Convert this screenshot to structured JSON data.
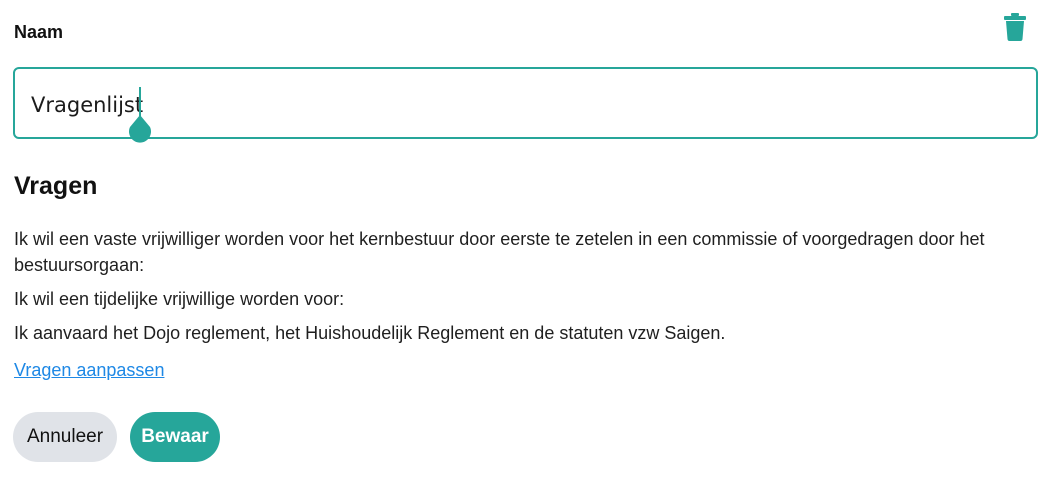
{
  "form": {
    "name_label": "Naam",
    "name_value": "Vragenlijst",
    "delete_icon": "trash-icon"
  },
  "questions_section": {
    "title": "Vragen",
    "items": [
      "Ik wil een vaste vrijwilliger worden voor het kernbestuur door eerste te zetelen in een commissie of voorgedragen door het bestuursorgaan:",
      "Ik wil een tijdelijke vrijwillige worden voor:",
      "Ik aanvaard het Dojo reglement, het Huishoudelijk Reglement en de statuten vzw Saigen."
    ],
    "edit_link": "Vragen aanpassen"
  },
  "actions": {
    "cancel_label": "Annuleer",
    "save_label": "Bewaar"
  },
  "colors": {
    "accent": "#26a69a",
    "link": "#1e88e5",
    "cancel_bg": "#e0e3e8"
  }
}
